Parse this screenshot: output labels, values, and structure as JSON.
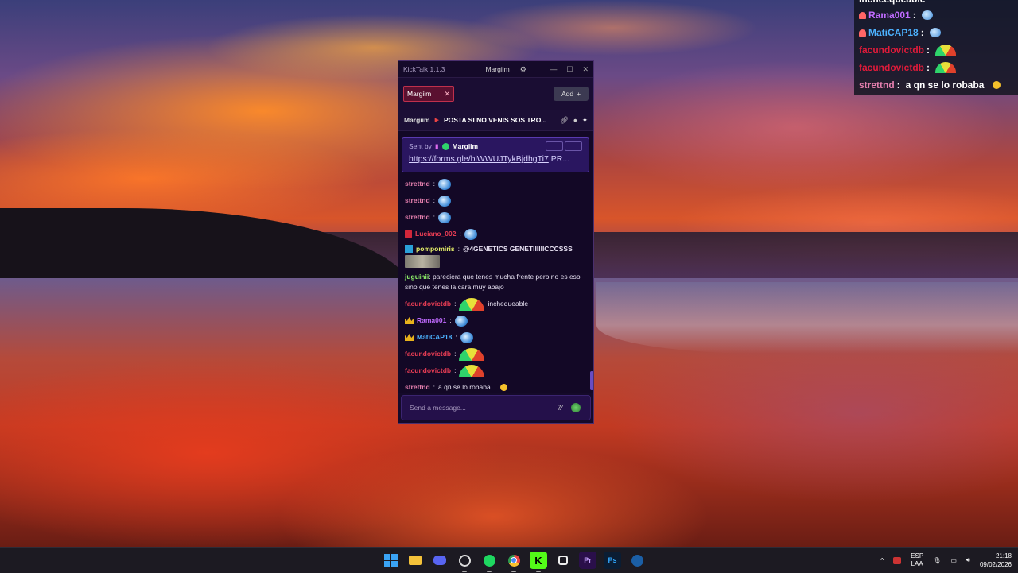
{
  "overlay": {
    "lines": [
      {
        "user": "incheequeable",
        "text": ""
      },
      {
        "user": "Rama001",
        "colon": ":"
      },
      {
        "user": "MatiCAP18",
        "colon": ":"
      },
      {
        "user": "facundovictdb",
        "colon": ":"
      },
      {
        "user": "facundovictdb",
        "colon": ":"
      },
      {
        "user": "strettnd",
        "colon": ":",
        "text": "a qn se lo robaba"
      }
    ]
  },
  "window": {
    "title": "KickTalk 1.1.3",
    "active_tab_name": "Margiim",
    "tab": {
      "label": "Margiim"
    },
    "add_label": "Add",
    "add_icon": "+",
    "pinned": {
      "user": "Margiim",
      "message": "POSTA SI NO VENIS SOS TRO..."
    },
    "sent_by": {
      "label": "Sent by",
      "user": "Margiim",
      "link": "https://forms.gle/biWWUJTykBjdhgTi7",
      "suffix": "PR..."
    },
    "messages": [
      {
        "user": "strettnd",
        "emote": "blue"
      },
      {
        "user": "strettnd",
        "emote": "blue"
      },
      {
        "user": "strettnd",
        "emote": "blue"
      },
      {
        "user": "Luciano_002",
        "emote": "blue"
      },
      {
        "user": "pompomiris",
        "text": "@4GENETICS GENETIIIIIICCCSSS"
      },
      {
        "user": "juguinii",
        "text": "pareciera que tenes mucha frente pero no es eso sino que tenes la cara muy abajo"
      },
      {
        "user": "facundovictdb",
        "text": "inchequeable"
      },
      {
        "user": "Rama001"
      },
      {
        "user": "MatiCAP18"
      },
      {
        "user": "facundovictdb"
      },
      {
        "user": "facundovictdb"
      },
      {
        "user": "strettnd",
        "text": "a qn se lo robaba"
      }
    ],
    "input_placeholder": "Send a message..."
  },
  "taskbar": {
    "lang_top": "ESP",
    "lang_bottom": "LAA",
    "time": "21:18",
    "date": "09/02/2026",
    "apps": [
      "start-icon",
      "file-explorer-icon",
      "discord-icon",
      "obs-icon",
      "spotify-icon",
      "chrome-icon",
      "kicktalk-icon",
      "app-icon",
      "premiere-icon",
      "photoshop-icon",
      "steam-icon"
    ],
    "labels": {
      "premiere": "Pr",
      "photoshop": "Ps",
      "kicktalk": "K"
    }
  }
}
